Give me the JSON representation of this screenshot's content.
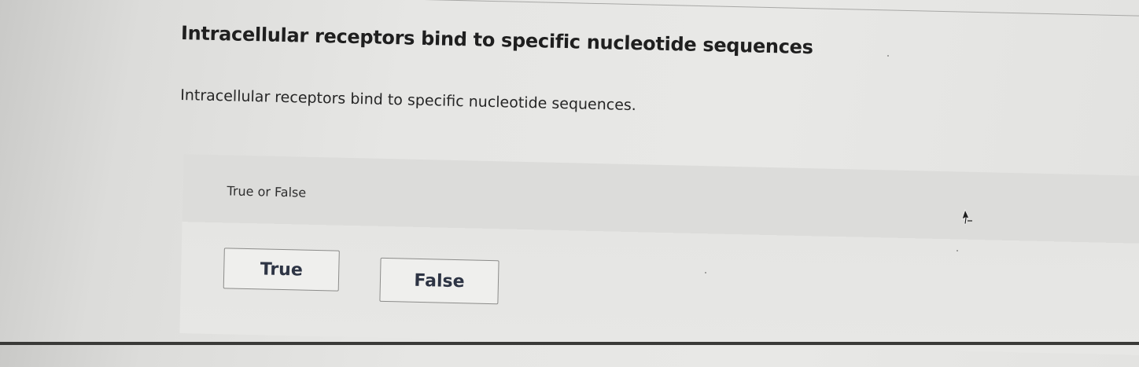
{
  "question": {
    "title": "Intracellular receptors bind to specific nucleotide sequences",
    "statement": "Intracellular receptors bind to specific nucleotide sequences."
  },
  "answer_panel": {
    "prompt": "True or False",
    "options": [
      {
        "label": "True"
      },
      {
        "label": "False"
      }
    ]
  },
  "icons": {
    "cursor": "mouse-pointer-icon"
  },
  "colors": {
    "background": "#e6e6e4",
    "panel": "#dcdcda",
    "button_text": "#2d3444",
    "button_border": "#8c8c8a"
  }
}
